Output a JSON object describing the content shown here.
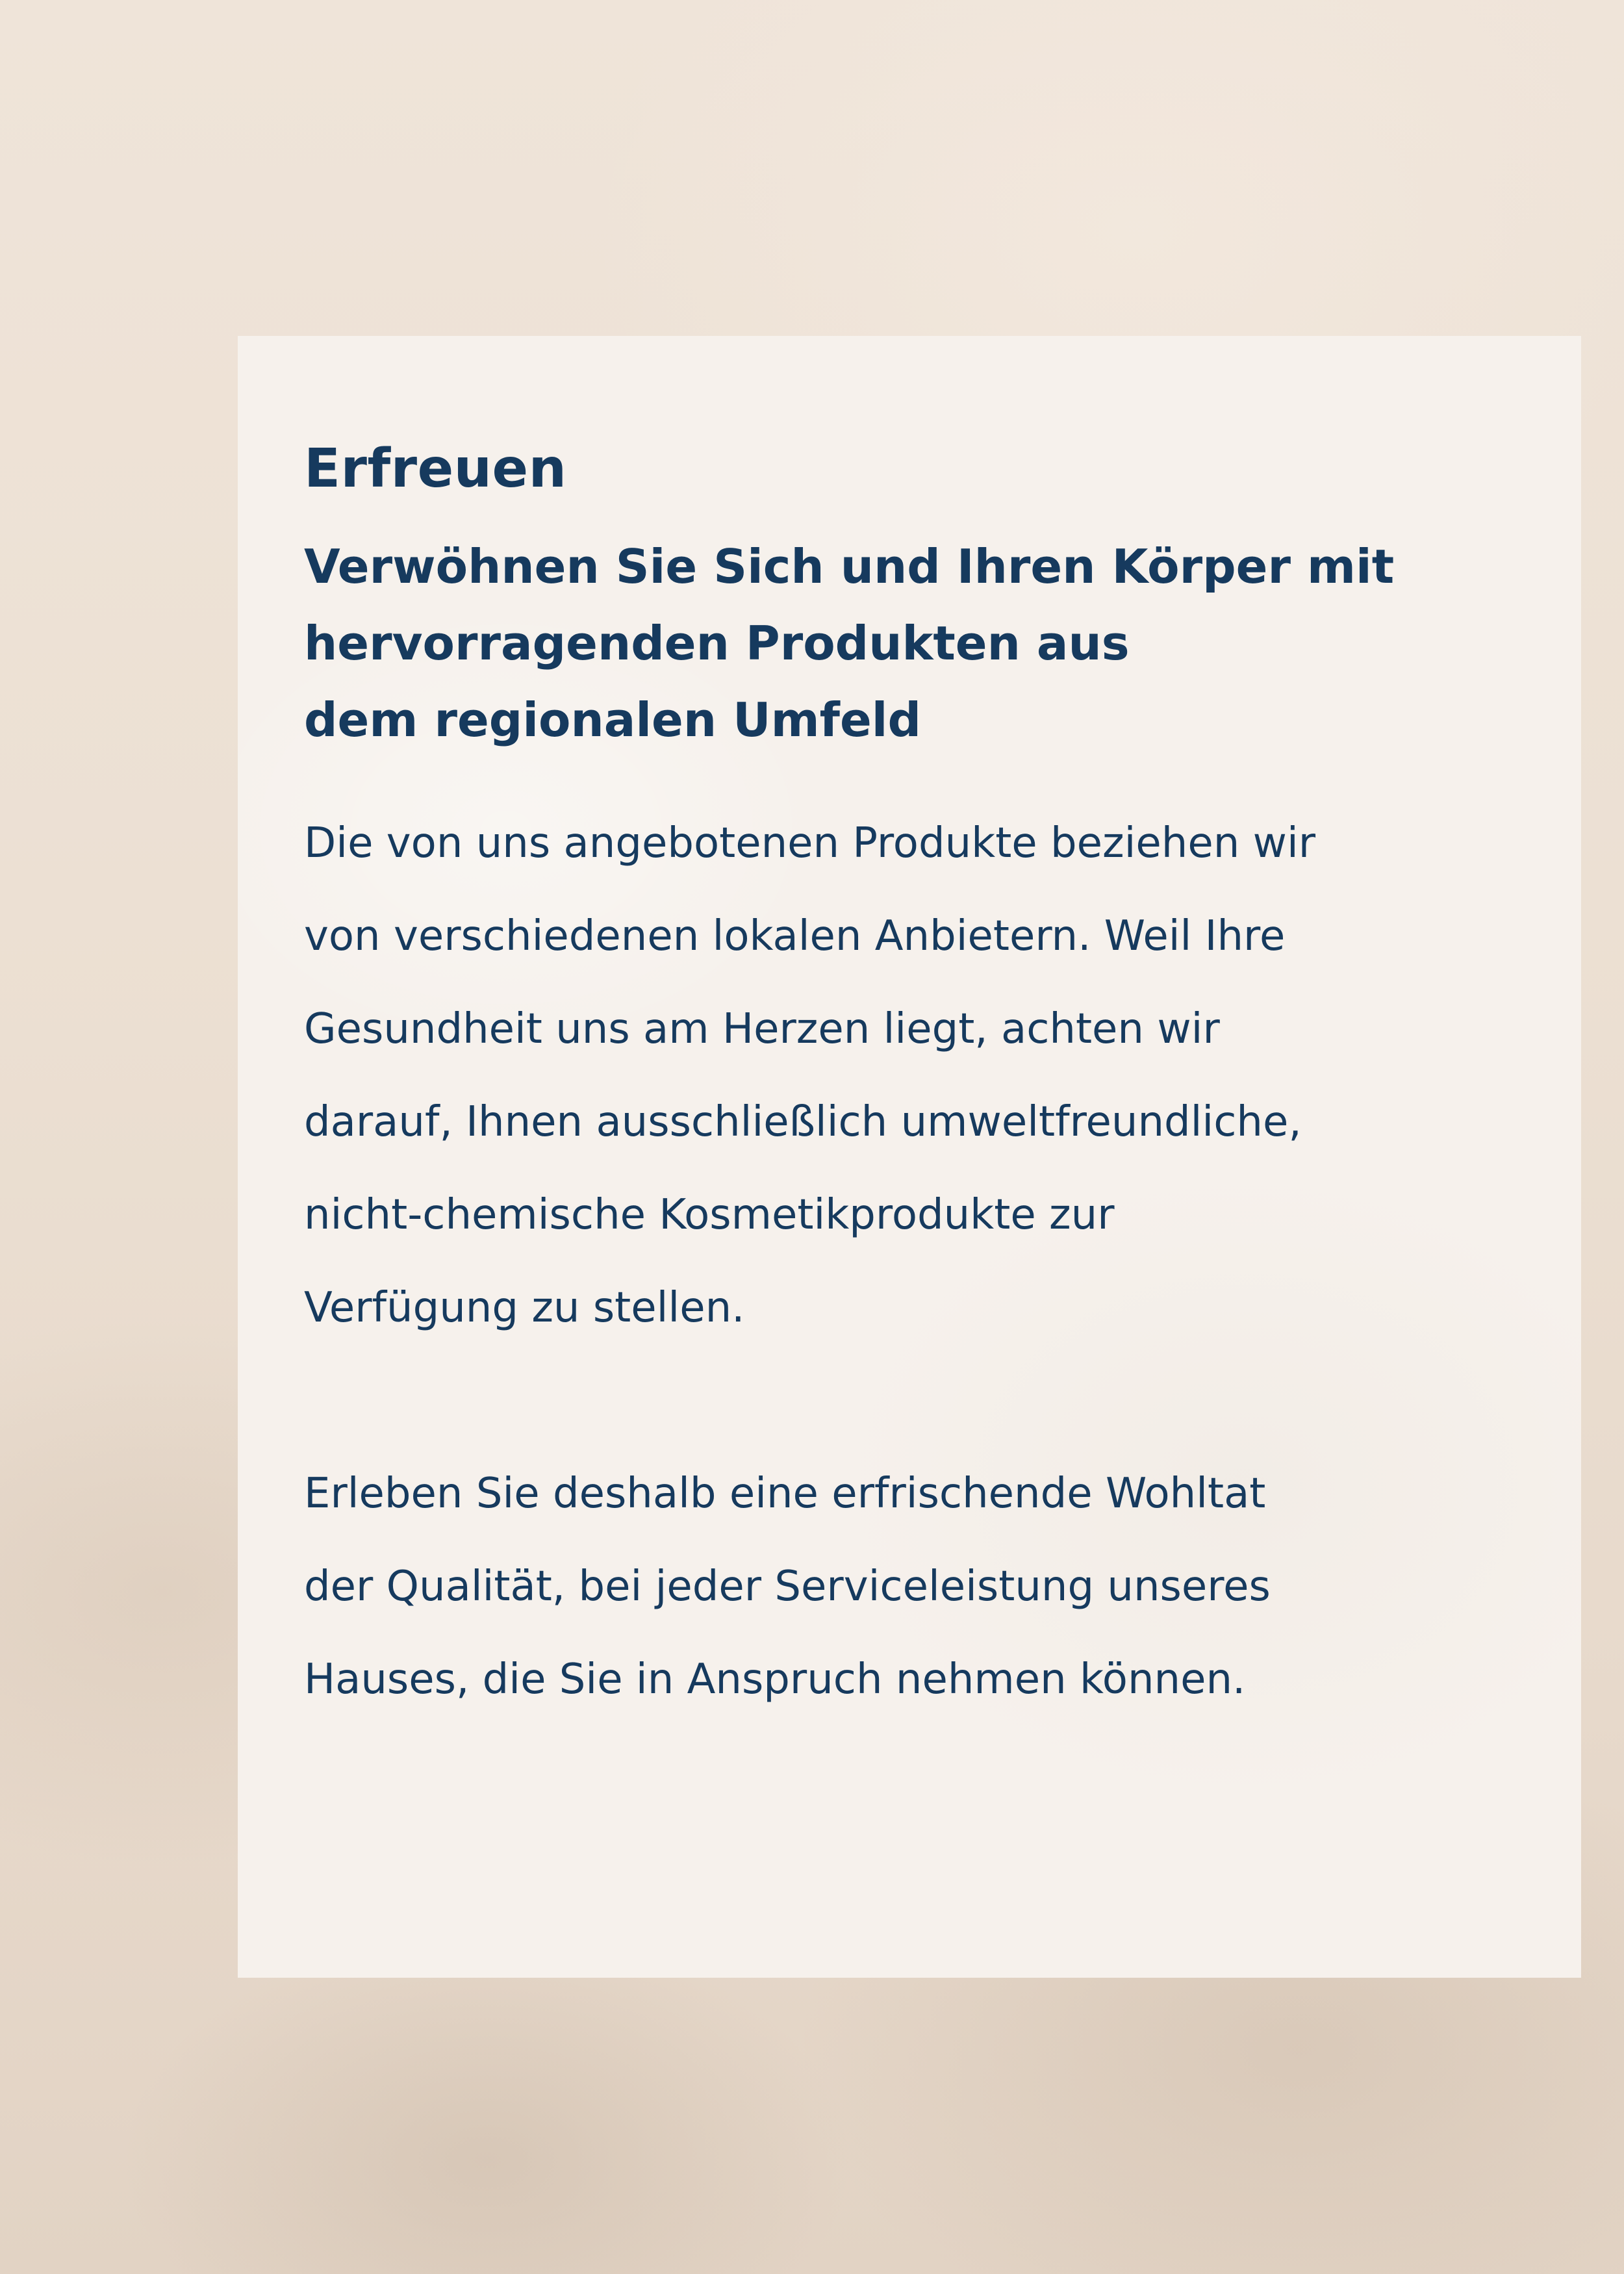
{
  "page": {
    "heading": "Erfreuen",
    "subheading_lines": [
      "Verwöhnen Sie Sich und Ihren Körper mit",
      "hervorragenden Produkten aus",
      "dem regionalen Umfeld"
    ],
    "paragraph1_lines": [
      "Die von uns angebotenen Produkte beziehen wir",
      "von verschiedenen lokalen Anbietern. Weil Ihre",
      "Gesundheit uns am Herzen liegt, achten wir",
      "darauf, Ihnen ausschließlich umweltfreundliche,",
      "nicht-chemische Kosmetikprodukte zur",
      "Verfügung zu stellen."
    ],
    "paragraph2_lines": [
      "Erleben Sie deshalb eine erfrischende Wohltat",
      "der Qualität, bei jeder Serviceleistung unseres",
      "Hauses, die Sie in Anspruch nehmen können."
    ]
  },
  "colors": {
    "text": "#163a5e",
    "card": "#f6f1ec",
    "background": "#ece0d3"
  }
}
